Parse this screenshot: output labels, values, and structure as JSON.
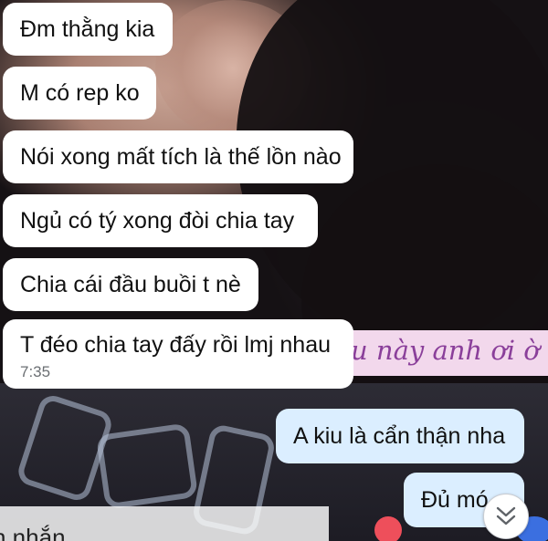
{
  "background": {
    "overlay_text": "u này anh ơi ờ",
    "bottom_text": "n nhắn"
  },
  "messages": [
    {
      "direction": "incoming",
      "text": "Đm thằng kia"
    },
    {
      "direction": "incoming",
      "text": "M có rep ko"
    },
    {
      "direction": "incoming",
      "text": "Nói xong mất tích là thế lồn nào"
    },
    {
      "direction": "incoming",
      "text": "Ngủ có tý xong đòi chia tay"
    },
    {
      "direction": "incoming",
      "text": "Chia cái đầu buồi t nè"
    },
    {
      "direction": "incoming",
      "text": "T đéo chia tay đấy rồi lmj nhau",
      "time": "7:35"
    },
    {
      "direction": "outgoing",
      "text": "A kiu là cẩn thận nha"
    },
    {
      "direction": "outgoing",
      "text": "Đủ mó"
    }
  ],
  "scroll_button": {
    "icon": "double-chevron-down-icon"
  },
  "colors": {
    "incoming_bubble": "#ffffff",
    "outgoing_bubble": "#dbeeff",
    "text": "#111111",
    "time": "#6b6f73",
    "overlay_text": "#8a3f9a"
  }
}
